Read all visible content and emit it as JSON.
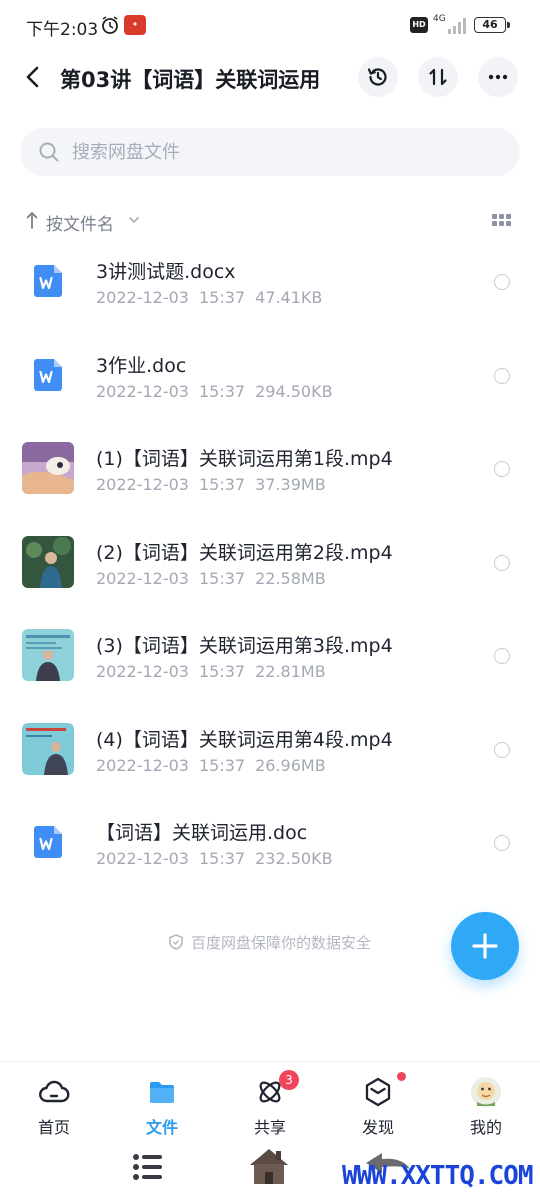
{
  "status_bar": {
    "time": "下午2:03",
    "network": "4G",
    "hd": "HD",
    "battery": "46"
  },
  "header": {
    "title": "第03讲【词语】关联词运用"
  },
  "search": {
    "placeholder": "搜索网盘文件"
  },
  "sort": {
    "label": "按文件名"
  },
  "files": [
    {
      "name": "3讲测试题.docx",
      "date": "2022-12-03",
      "time": "15:37",
      "size": "47.41KB",
      "type": "doc"
    },
    {
      "name": "3作业.doc",
      "date": "2022-12-03",
      "time": "15:37",
      "size": "294.50KB",
      "type": "doc"
    },
    {
      "name": "(1)【词语】关联词运用第1段.mp4",
      "date": "2022-12-03",
      "time": "15:37",
      "size": "37.39MB",
      "type": "video"
    },
    {
      "name": "(2)【词语】关联词运用第2段.mp4",
      "date": "2022-12-03",
      "time": "15:37",
      "size": "22.58MB",
      "type": "video"
    },
    {
      "name": "(3)【词语】关联词运用第3段.mp4",
      "date": "2022-12-03",
      "time": "15:37",
      "size": "22.81MB",
      "type": "video"
    },
    {
      "name": "(4)【词语】关联词运用第4段.mp4",
      "date": "2022-12-03",
      "time": "15:37",
      "size": "26.96MB",
      "type": "video"
    },
    {
      "name": "【词语】关联词运用.doc",
      "date": "2022-12-03",
      "time": "15:37",
      "size": "232.50KB",
      "type": "doc"
    }
  ],
  "footer_note": "百度网盘保障你的数据安全",
  "tabs": [
    {
      "label": "首页"
    },
    {
      "label": "文件"
    },
    {
      "label": "共享",
      "badge": "3"
    },
    {
      "label": "发现"
    },
    {
      "label": "我的"
    }
  ],
  "watermark": "WWW.XXTTQ.COM",
  "colors": {
    "accent": "#2d9bef",
    "fab": "#2fa9f5",
    "badge": "#f0445a",
    "doc_icon": "#3f8df5"
  }
}
